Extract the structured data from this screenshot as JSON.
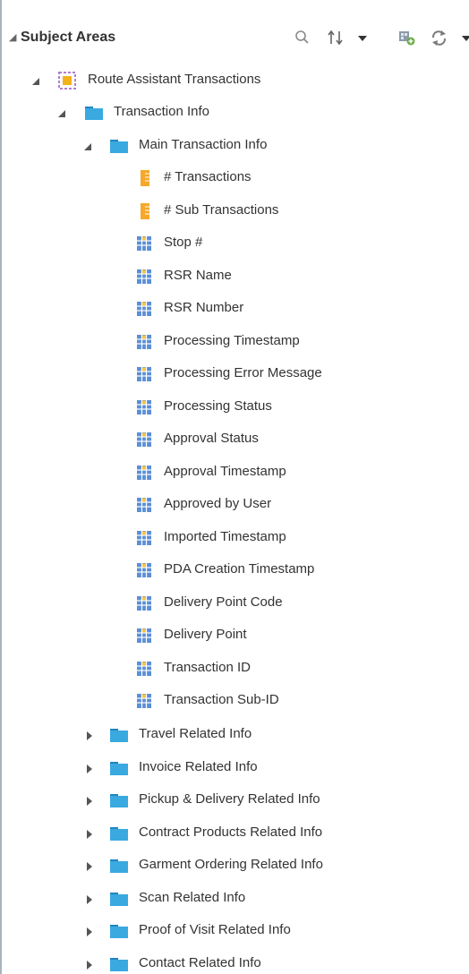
{
  "header": {
    "title": "Subject Areas"
  },
  "tree": {
    "root": {
      "label": "Route Assistant Transactions"
    },
    "folder": {
      "label": "Transaction Info"
    },
    "subfolder": {
      "label": "Main Transaction Info"
    },
    "measures": [
      {
        "label": "# Transactions"
      },
      {
        "label": "# Sub Transactions"
      }
    ],
    "columns": [
      {
        "label": "Stop #"
      },
      {
        "label": "RSR Name"
      },
      {
        "label": "RSR Number"
      },
      {
        "label": "Processing Timestamp"
      },
      {
        "label": "Processing Error Message"
      },
      {
        "label": "Processing Status"
      },
      {
        "label": "Approval Status"
      },
      {
        "label": "Approval Timestamp"
      },
      {
        "label": "Approved by User"
      },
      {
        "label": "Imported Timestamp"
      },
      {
        "label": "PDA Creation Timestamp"
      },
      {
        "label": "Delivery Point Code"
      },
      {
        "label": "Delivery Point"
      },
      {
        "label": "Transaction ID"
      },
      {
        "label": "Transaction Sub-ID"
      }
    ],
    "collapsed_folders": [
      {
        "label": "Travel Related Info"
      },
      {
        "label": "Invoice Related Info"
      },
      {
        "label": "Pickup & Delivery Related Info"
      },
      {
        "label": "Contract Products Related Info"
      },
      {
        "label": "Garment Ordering Related Info"
      },
      {
        "label": "Scan Related Info"
      },
      {
        "label": "Proof of Visit Related Info"
      },
      {
        "label": "Contact Related Info"
      }
    ]
  },
  "colors": {
    "folder": "#39a9e0",
    "folder_dark": "#1f86c2",
    "measure": "#f4a92c",
    "column": "#5b8fd6",
    "root_square": "#f2b21d",
    "root_frame": "#b07fd0"
  }
}
